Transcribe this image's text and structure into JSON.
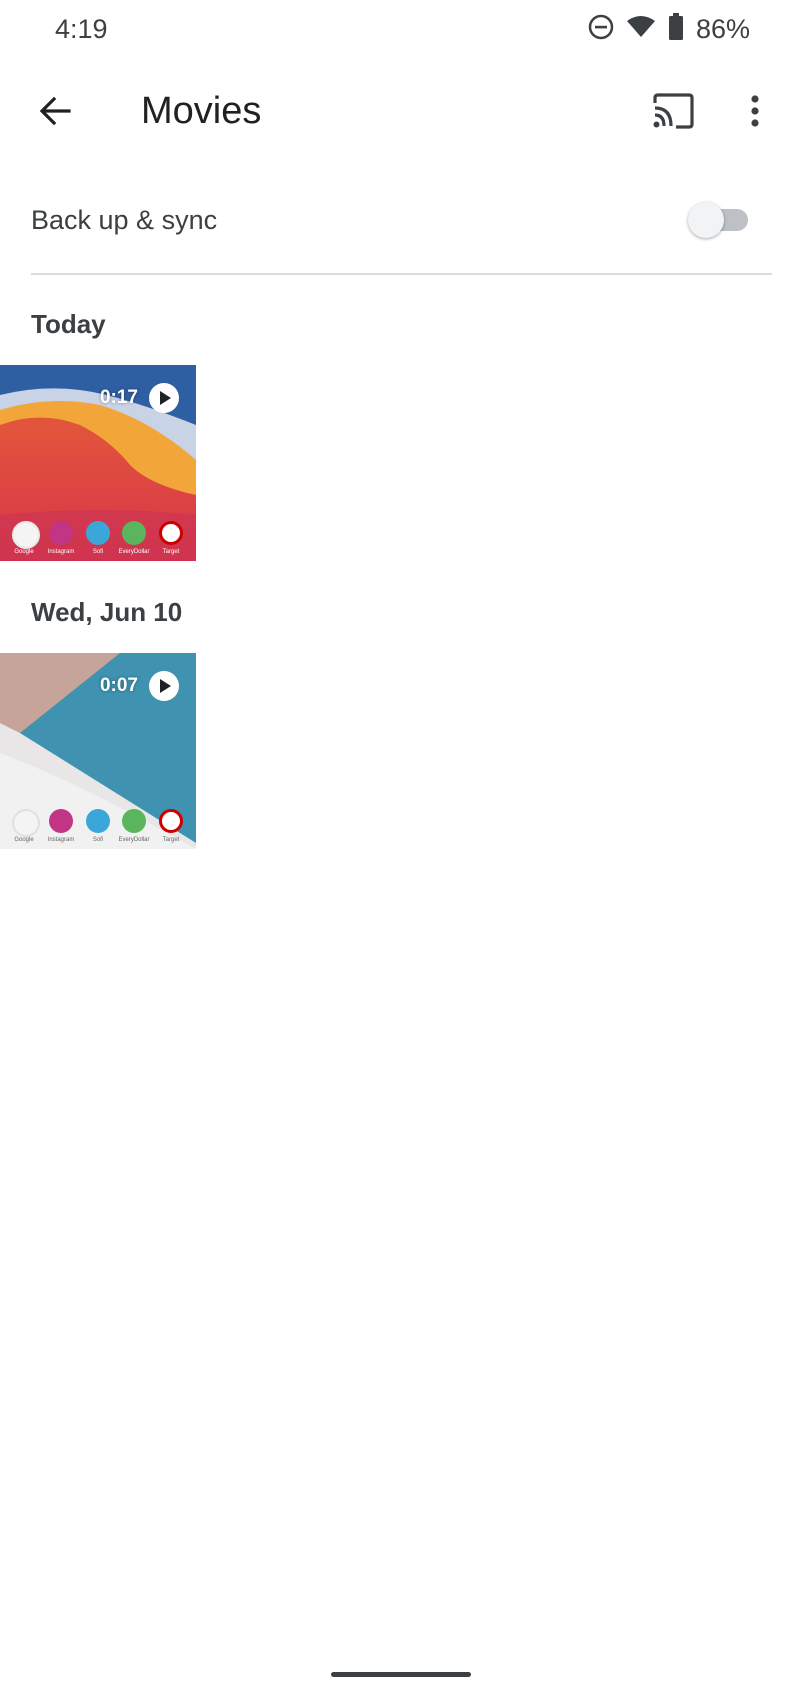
{
  "status_bar": {
    "time": "4:19",
    "battery_percent": "86%",
    "icons": [
      "do-not-disturb-icon",
      "wifi-icon",
      "battery-icon"
    ]
  },
  "app_bar": {
    "title": "Movies",
    "icons": [
      "back-arrow-icon",
      "cast-icon",
      "more-vert-icon"
    ]
  },
  "backup": {
    "label": "Back up & sync",
    "enabled": false
  },
  "sections": [
    {
      "header": "Today",
      "videos": [
        {
          "duration": "0:17",
          "dock_labels": [
            "Google",
            "Instagram",
            "Sofi",
            "EveryDollar",
            "Target"
          ]
        }
      ]
    },
    {
      "header": "Wed, Jun 10",
      "videos": [
        {
          "duration": "0:07",
          "dock_labels": [
            "Google",
            "Instagram",
            "Sofi",
            "EveryDollar",
            "Target"
          ]
        }
      ]
    }
  ],
  "colors": {
    "text_primary": "#202124",
    "text_secondary": "#3c4043",
    "divider": "#dadce0",
    "toggle_track_off": "#bdc1c6"
  }
}
